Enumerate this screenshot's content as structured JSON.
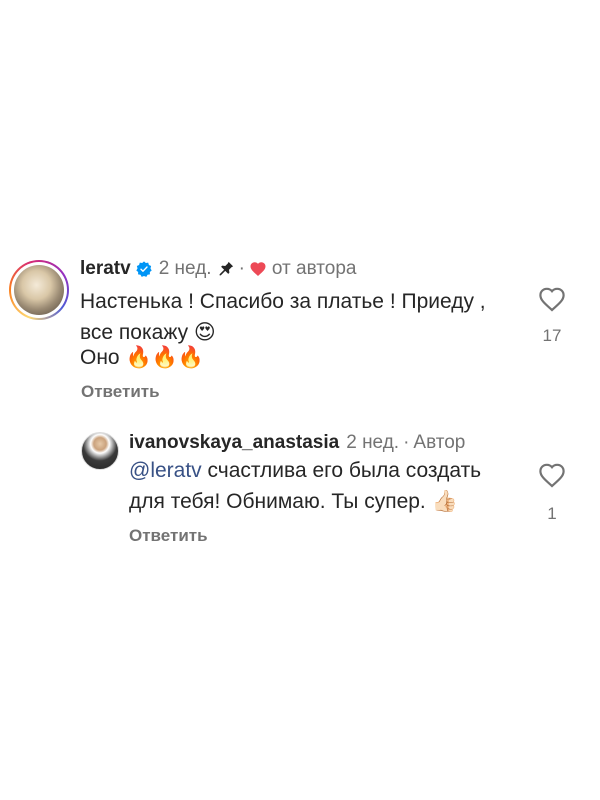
{
  "comments": [
    {
      "username": "leratv",
      "time": "2 нед.",
      "separator": "·",
      "author_note": "от автора",
      "lines": [
        "Настенька ! Спасибо за платье ! Приеду ,",
        "все покажу 😍",
        "Оно 🔥🔥🔥"
      ],
      "reply_label": "Ответить",
      "like_count": "17",
      "icons": {
        "verified": "verified-badge-icon",
        "pin": "pin-icon",
        "heart": "heart-filled-icon",
        "like": "heart-outline-icon"
      },
      "colors": {
        "verified": "#0095f6",
        "heart": "#ed4956"
      }
    },
    {
      "username": "ivanovskaya_anastasia",
      "time": "2 нед.",
      "separator": "·",
      "author_label": "Автор",
      "mention": "@leratv",
      "line1_rest": " счастлива его была создать",
      "line2": "для тебя! Обнимаю. Ты супер. 👍🏻",
      "reply_label": "Ответить",
      "like_count": "1",
      "icons": {
        "like": "heart-outline-icon"
      }
    }
  ]
}
